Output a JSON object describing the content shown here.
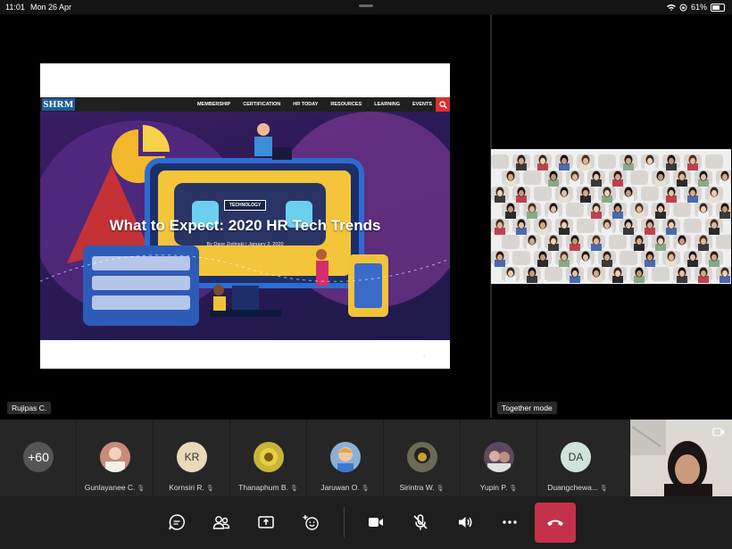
{
  "status_bar": {
    "time": "11:01",
    "date": "Mon 26 Apr",
    "battery": "61%"
  },
  "slide": {
    "logo": "SHRM",
    "nav": [
      "MEMBERSHIP",
      "CERTIFICATION",
      "HR TODAY",
      "RESOURCES",
      "LEARNING",
      "EVENTS"
    ],
    "badge": "TECHNOLOGY",
    "title": "What to Expect: 2020 HR Tech Trends",
    "byline": "By Dave Zielinski  |  January 2, 2020"
  },
  "presenter_name": "Rujipas C.",
  "together_mode_label": "Together mode",
  "overflow_count": "+60",
  "participants": [
    {
      "name": "Gunlayanee C.",
      "initials": "",
      "avatar_color": "#c98a7a"
    },
    {
      "name": "Kornsiri R.",
      "initials": "KR",
      "avatar_color": "#e8d9b8"
    },
    {
      "name": "Thanaphum B.",
      "initials": "",
      "avatar_color": "#c7b53a"
    },
    {
      "name": "Jaruwan O.",
      "initials": "",
      "avatar_color": "#8ab0d8"
    },
    {
      "name": "Sirintra W.",
      "initials": "",
      "avatar_color": "#6b6b55"
    },
    {
      "name": "Yupin P.",
      "initials": "",
      "avatar_color": "#5b4a5f"
    },
    {
      "name": "Duangchewa...",
      "initials": "DA",
      "avatar_color": "#cfe3d9"
    }
  ],
  "toolbar": {
    "icons": [
      "chat-icon",
      "people-icon",
      "share-screen-icon",
      "reactions-icon",
      "camera-icon",
      "mic-off-icon",
      "speaker-icon",
      "more-icon",
      "hang-up-icon"
    ],
    "hangup_color": "#c4314b"
  }
}
